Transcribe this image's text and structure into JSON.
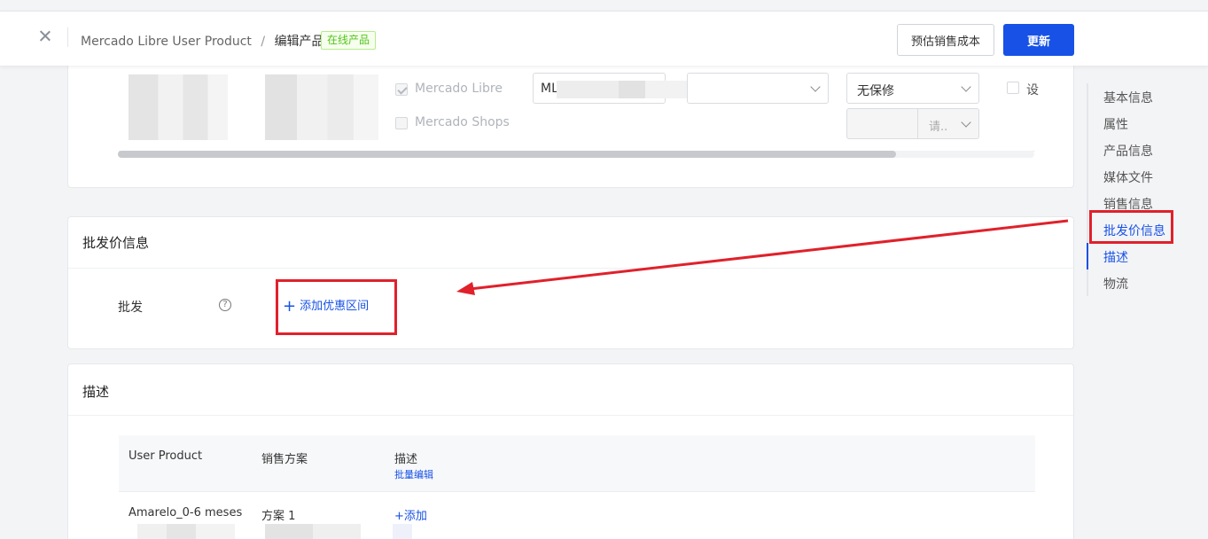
{
  "header": {
    "breadcrumb_root": "Mercado Libre User Product",
    "breadcrumb_sep": "/",
    "breadcrumb_current": "编辑产品",
    "status_badge": "在线产品",
    "estimate_button": "预估销售成本",
    "update_button": "更新"
  },
  "channels": {
    "ml_label": "Mercado Libre",
    "shops_label": "Mercado Shops",
    "ml_prefix": "ML",
    "warranty_value": "无保修",
    "select_placeholder": "请..",
    "checkbox_label": "设"
  },
  "wholesale": {
    "title": "批发价信息",
    "row_label": "批发",
    "help_glyph": "?",
    "add_range_plus": "+",
    "add_range": "添加优惠区间"
  },
  "description": {
    "title": "描述",
    "columns": [
      "User Product",
      "销售方案",
      "描述"
    ],
    "bulk_edit": "批量编辑",
    "rows": [
      {
        "product": "Amarelo_0-6 meses",
        "plan": "方案 1",
        "action": "+添加"
      }
    ]
  },
  "nav": {
    "items": [
      "基本信息",
      "属性",
      "产品信息",
      "媒体文件",
      "销售信息",
      "批发价信息",
      "描述",
      "物流"
    ]
  },
  "colors": {
    "primary": "#1751e6",
    "annotation_red": "#e0212b",
    "success": "#52c41a"
  }
}
